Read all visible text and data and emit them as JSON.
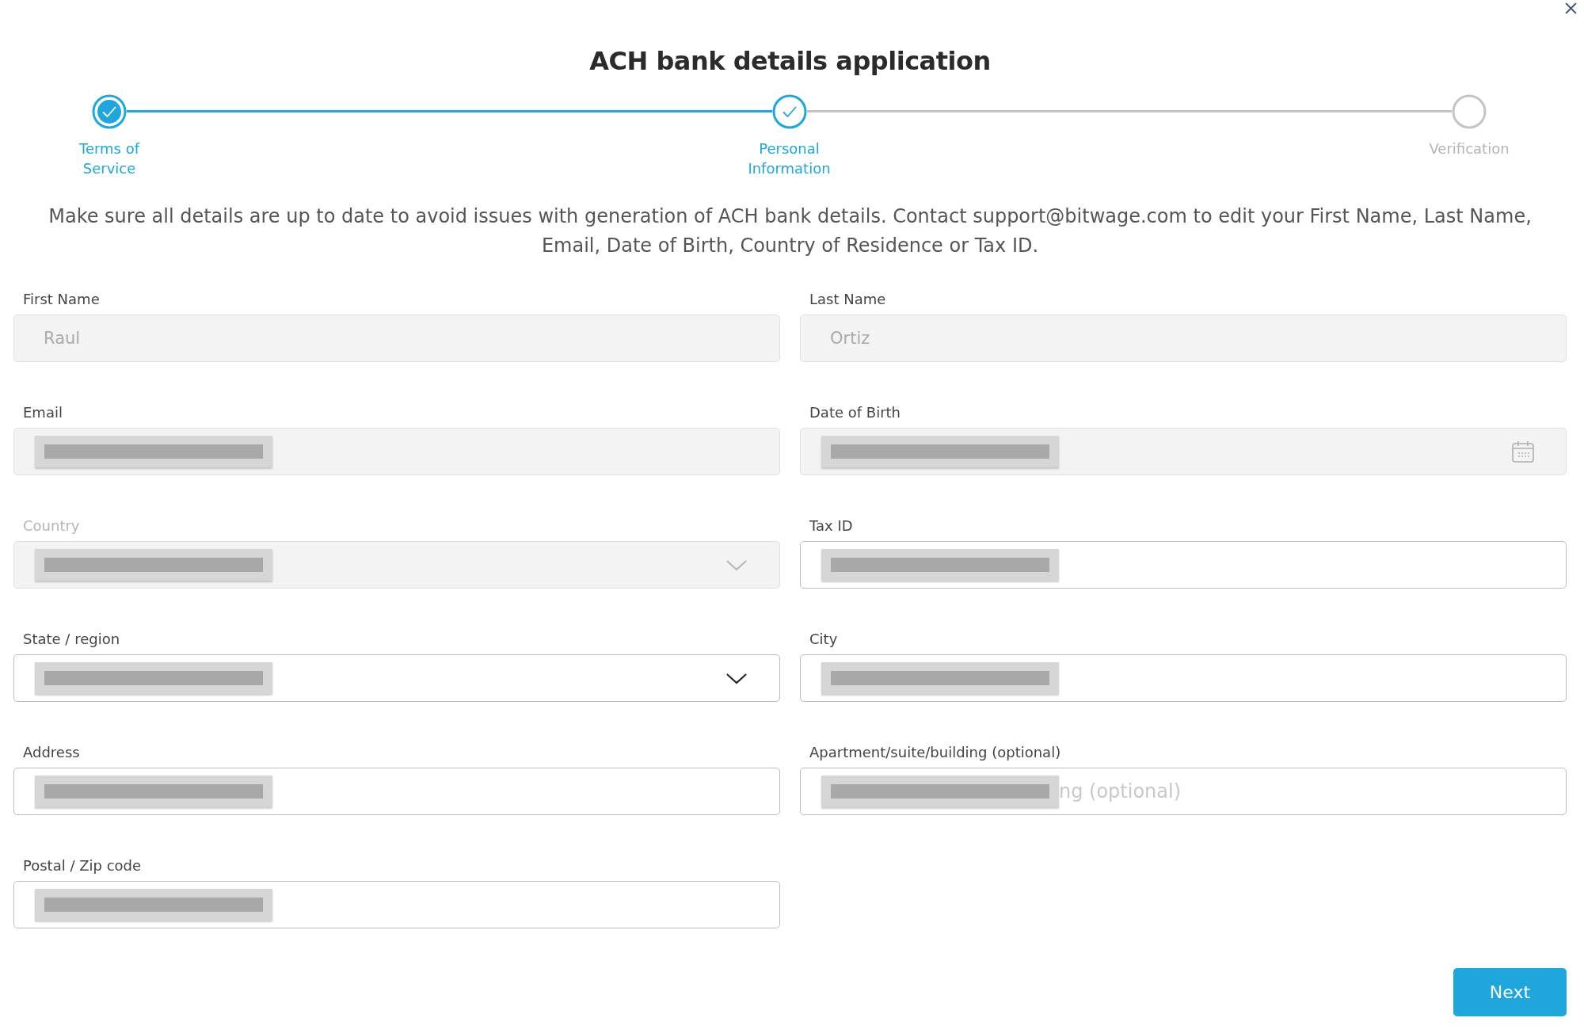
{
  "title": "ACH bank details application",
  "steps": [
    {
      "label": "Terms of Service",
      "completed": true,
      "selected": false
    },
    {
      "label": "Personal Information",
      "completed": true,
      "selected": true
    },
    {
      "label": "Verification",
      "completed": false,
      "selected": false
    }
  ],
  "notice": "Make sure all details are up to date to avoid issues with generation of ACH bank details. Contact support@bitwage.com to edit your First Name, Last Name, Email, Date of Birth, Country of Residence or Tax ID.",
  "fields": [
    {
      "label": "First Name",
      "kind": "text",
      "disabled": true,
      "label_muted": false,
      "value": "Raul"
    },
    {
      "label": "Last Name",
      "kind": "text",
      "disabled": true,
      "label_muted": false,
      "value": "Ortiz"
    },
    {
      "label": "Email",
      "kind": "text",
      "disabled": true,
      "label_muted": false,
      "redacted": true
    },
    {
      "label": "Date of Birth",
      "kind": "date",
      "disabled": true,
      "label_muted": false,
      "redacted": true
    },
    {
      "label": "Country",
      "kind": "select",
      "disabled": true,
      "label_muted": true,
      "redacted": true
    },
    {
      "label": "Tax ID",
      "kind": "text",
      "disabled": false,
      "label_muted": false,
      "redacted": true
    },
    {
      "label": "State / region",
      "kind": "select",
      "disabled": false,
      "label_muted": false,
      "redacted": true
    },
    {
      "label": "City",
      "kind": "text",
      "disabled": false,
      "label_muted": false,
      "redacted": true
    },
    {
      "label": "Address",
      "kind": "text",
      "disabled": false,
      "label_muted": false,
      "redacted": true
    },
    {
      "label": "Apartment/suite/building (optional)",
      "kind": "text",
      "disabled": false,
      "label_muted": false,
      "redacted": true,
      "placeholder": "ng (optional)"
    },
    {
      "label": "Postal / Zip code",
      "kind": "text",
      "disabled": false,
      "label_muted": false,
      "redacted": true
    }
  ],
  "next_button": "Next"
}
